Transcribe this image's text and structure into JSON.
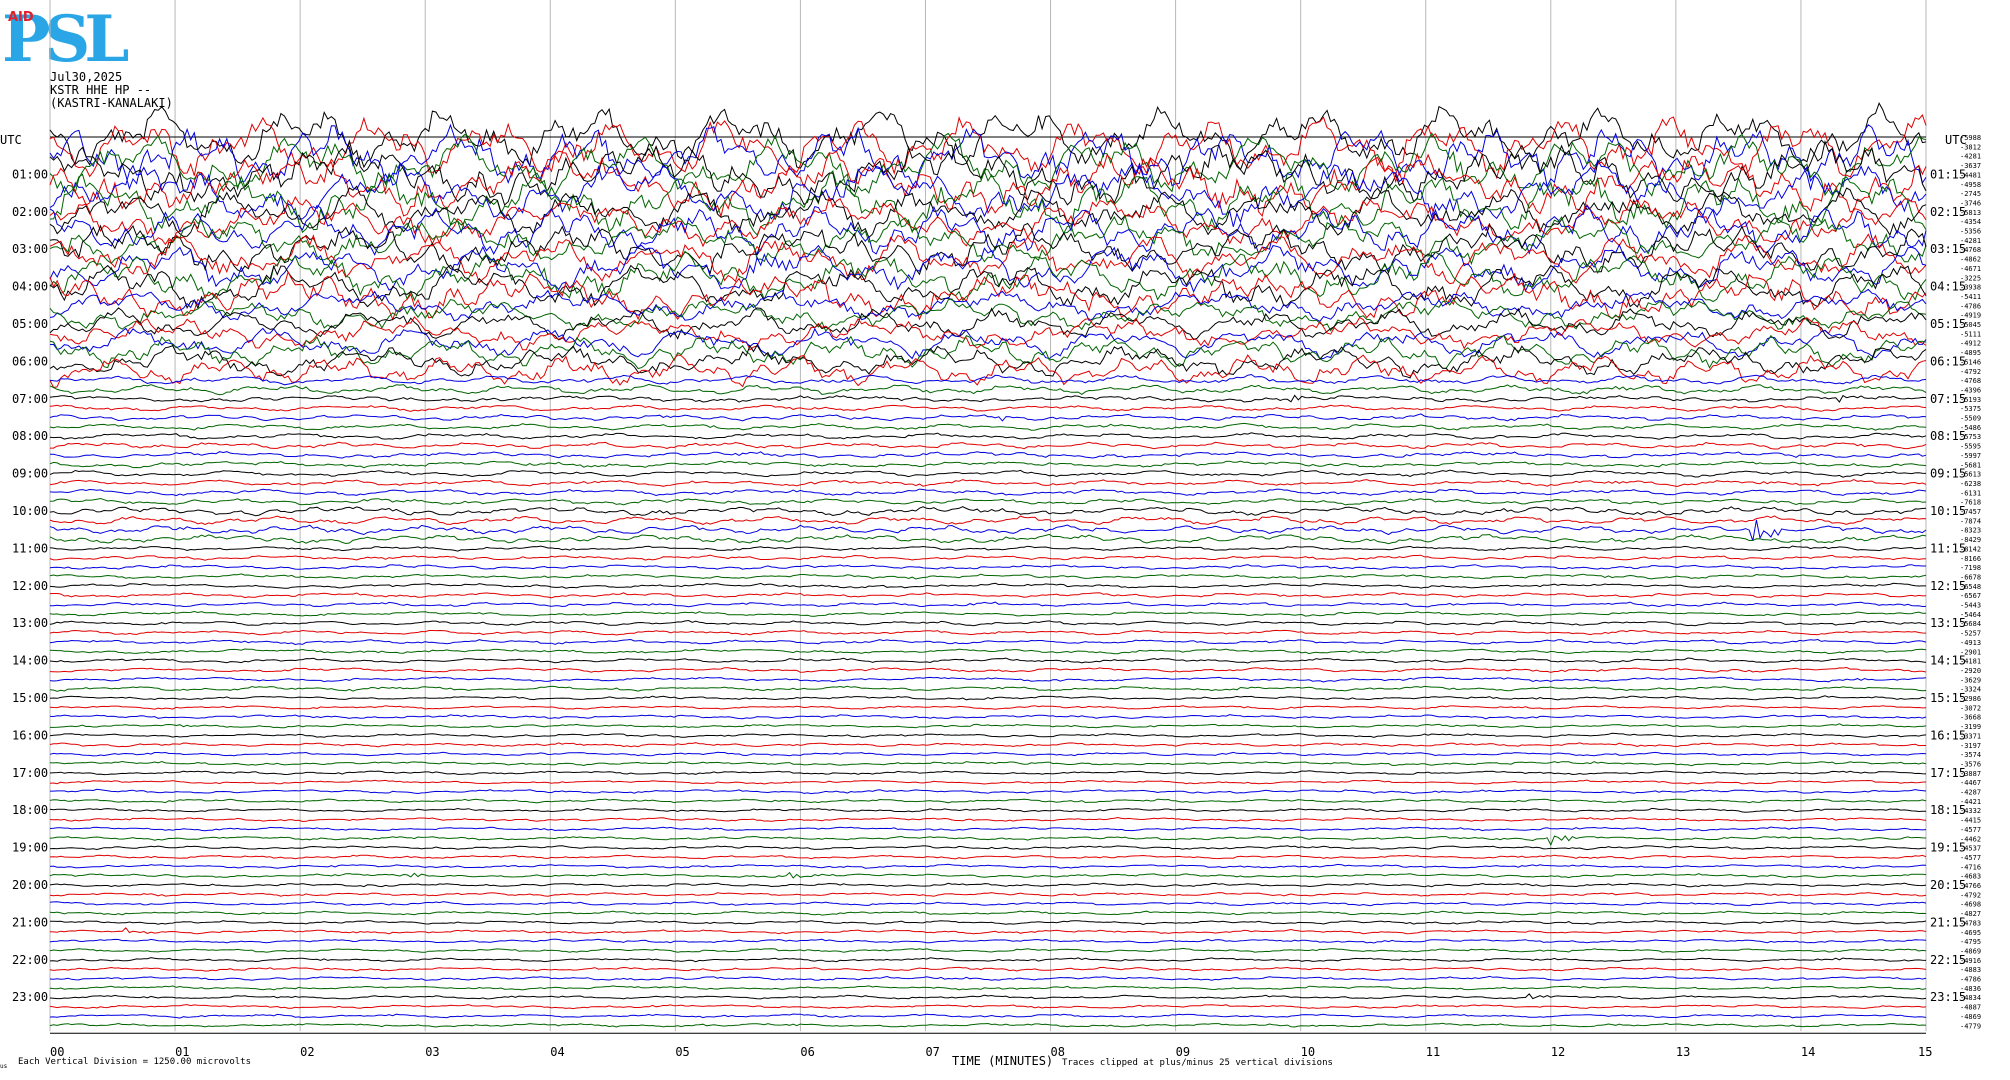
{
  "header": {
    "logo_main": "PSL",
    "logo_small": "AID",
    "date": "Jul30,2025",
    "station": "KSTR HHE HP --",
    "location": "(KASTRI-KANALAKI)"
  },
  "footer": {
    "division": "Each Vertical Division = 1250.00 microvolts",
    "xlabel": "TIME (MINUTES)",
    "clip_note": "Traces clipped at plus/minus 25 vertical divisions",
    "corner_mark": "us"
  },
  "chart_data": {
    "type": "line",
    "title": "",
    "xlabel": "TIME (MINUTES)",
    "ylabel_left": "UTC",
    "ylabel_right": "UTC",
    "x_ticks": [
      "00",
      "01",
      "02",
      "03",
      "04",
      "05",
      "06",
      "07",
      "08",
      "09",
      "10",
      "11",
      "12",
      "13",
      "14",
      "15"
    ],
    "xlim": [
      0,
      15
    ],
    "left_hour_labels": [
      "01:00",
      "02:00",
      "03:00",
      "04:00",
      "05:00",
      "06:00",
      "07:00",
      "08:00",
      "09:00",
      "10:00",
      "11:00",
      "12:00",
      "13:00",
      "14:00",
      "15:00",
      "16:00",
      "17:00",
      "18:00",
      "19:00",
      "20:00",
      "21:00",
      "22:00",
      "23:00"
    ],
    "right_hour_labels": [
      "01:15",
      "02:15",
      "03:15",
      "04:15",
      "05:15",
      "06:15",
      "07:15",
      "08:15",
      "09:15",
      "10:15",
      "11:15",
      "12:15",
      "13:15",
      "14:15",
      "15:15",
      "16:15",
      "17:15",
      "18:15",
      "19:15",
      "20:15",
      "21:15",
      "22:15",
      "23:15"
    ],
    "trace_colors": [
      "#000000",
      "#e00000",
      "#0000e0",
      "#006400"
    ],
    "trace_count": 96,
    "trace_minutes_each": 15,
    "grid": true,
    "offset_labels": [
      "-5988",
      "-3812",
      "-4281",
      "-3637",
      "-4481",
      "-4958",
      "-2745",
      "-3746",
      "-5813",
      "-4354",
      "-5356",
      "-4281",
      "-4768",
      "-4862",
      "-4671",
      "-3225",
      "-3938",
      "-5411",
      "-4786",
      "-4919",
      "-5045",
      "-5111",
      "-4912",
      "-4895",
      "-5146",
      "-4792",
      "-4768",
      "-4396",
      "-5193",
      "-5375",
      "-5509",
      "-5486",
      "-5753",
      "-5595",
      "-5997",
      "-5681",
      "-5613",
      "-6238",
      "-6131",
      "-7618",
      "-7457",
      "-7874",
      "-8323",
      "-8429",
      "-8142",
      "-8166",
      "-7198",
      "-6678",
      "-6548",
      "-6567",
      "-5443",
      "-5464",
      "-5684",
      "-5257",
      "-4913",
      "-2901",
      "-4181",
      "-2920",
      "-3629",
      "-3324",
      "-2986",
      "-3072",
      "-3668",
      "-3199",
      "-3371",
      "-3197",
      "-3574",
      "-3576",
      "-3887",
      "-4467",
      "-4287",
      "-4421",
      "-4332",
      "-4415",
      "-4577",
      "-4462",
      "-4537",
      "-4577",
      "-4716",
      "-4683",
      "-4766",
      "-4792",
      "-4698",
      "-4827",
      "-4783",
      "-4695",
      "-4795",
      "-4869",
      "-4916",
      "-4883",
      "-4786",
      "-4836",
      "-4834",
      "-4887",
      "-4869",
      "-4779"
    ],
    "events": [
      {
        "trace": 12,
        "minute": 0.2,
        "amp": 5,
        "len": 0.6
      },
      {
        "trace": 28,
        "minute": 9.9,
        "amp": 4,
        "len": 0.25
      },
      {
        "trace": 28,
        "minute": 14.3,
        "amp": 4,
        "len": 0.25
      },
      {
        "trace": 30,
        "minute": 7.6,
        "amp": 3,
        "len": 0.2
      },
      {
        "trace": 42,
        "minute": 13.6,
        "amp": 14,
        "len": 0.35
      },
      {
        "trace": 59,
        "minute": 9.5,
        "amp": 3,
        "len": 0.2
      },
      {
        "trace": 75,
        "minute": 12.0,
        "amp": 9,
        "len": 0.25
      },
      {
        "trace": 79,
        "minute": 2.8,
        "amp": 4,
        "len": 0.4
      },
      {
        "trace": 79,
        "minute": 5.9,
        "amp": 3,
        "len": 0.4
      },
      {
        "trace": 85,
        "minute": 0.6,
        "amp": 3,
        "len": 0.3
      },
      {
        "trace": 92,
        "minute": 11.8,
        "amp": 6,
        "len": 0.2
      }
    ]
  }
}
